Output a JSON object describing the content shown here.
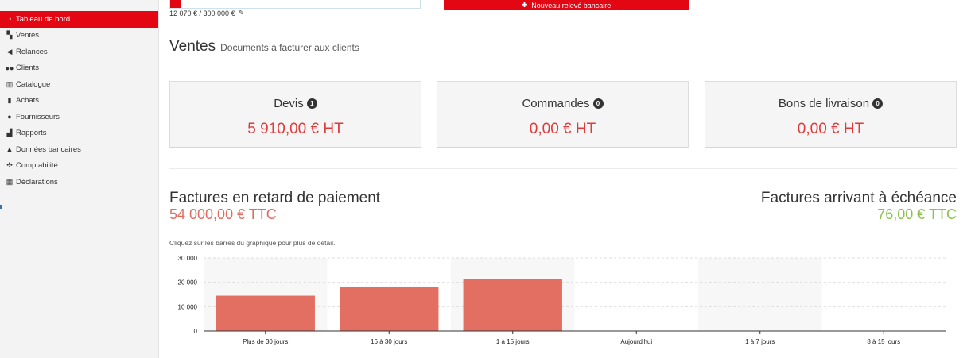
{
  "sidebar": {
    "items": [
      {
        "label": "Tableau de bord",
        "icon": "dashboard-icon",
        "glyph": "◔",
        "active": true
      },
      {
        "label": "Ventes",
        "icon": "sales-icon",
        "glyph": "▚"
      },
      {
        "label": "Relances",
        "icon": "megaphone-icon",
        "glyph": "◀"
      },
      {
        "label": "Clients",
        "icon": "users-icon",
        "glyph": "●●"
      },
      {
        "label": "Catalogue",
        "icon": "books-icon",
        "glyph": "▥"
      },
      {
        "label": "Achats",
        "icon": "bag-icon",
        "glyph": "▮"
      },
      {
        "label": "Fournisseurs",
        "icon": "user-icon",
        "glyph": "●"
      },
      {
        "label": "Rapports",
        "icon": "bar-chart-icon",
        "glyph": "▟"
      },
      {
        "label": "Données bancaires",
        "icon": "bank-icon",
        "glyph": "▲"
      },
      {
        "label": "Comptabilité",
        "icon": "network-icon",
        "glyph": "✣"
      },
      {
        "label": "Déclarations",
        "icon": "calculator-icon",
        "glyph": "▦"
      }
    ]
  },
  "header": {
    "quota_text": "12 070 € / 300 000 €",
    "quota_fraction": 0.0402,
    "new_bank_statement_label": "Nouveau relevé bancaire"
  },
  "sales": {
    "title": "Ventes",
    "subtitle": "Documents à facturer aux clients",
    "cards": [
      {
        "label": "Devis",
        "count": "1",
        "value": "5 910,00 € HT"
      },
      {
        "label": "Commandes",
        "count": "0",
        "value": "0,00 € HT"
      },
      {
        "label": "Bons de livraison",
        "count": "0",
        "value": "0,00 € HT"
      }
    ]
  },
  "invoices": {
    "late_title": "Factures en retard de paiement",
    "late_value": "54 000,00 € TTC",
    "due_title": "Factures arrivant à échéance",
    "due_value": "76,00 € TTC",
    "hint": "Cliquez sur les barres du graphique pour plus de détail."
  },
  "chart_data": {
    "type": "bar",
    "categories": [
      "Plus de 30 jours",
      "16 à 30 jours",
      "1 à 15 jours",
      "Aujourd'hui",
      "1 à 7 jours",
      "8 à 15 jours"
    ],
    "values": [
      14500,
      18000,
      21500,
      0,
      0,
      0
    ],
    "yticks": [
      "0",
      "10 000",
      "20 000",
      "30 000"
    ],
    "ylim": [
      0,
      30000
    ],
    "bar_color": "#e36f63",
    "grid": true
  }
}
